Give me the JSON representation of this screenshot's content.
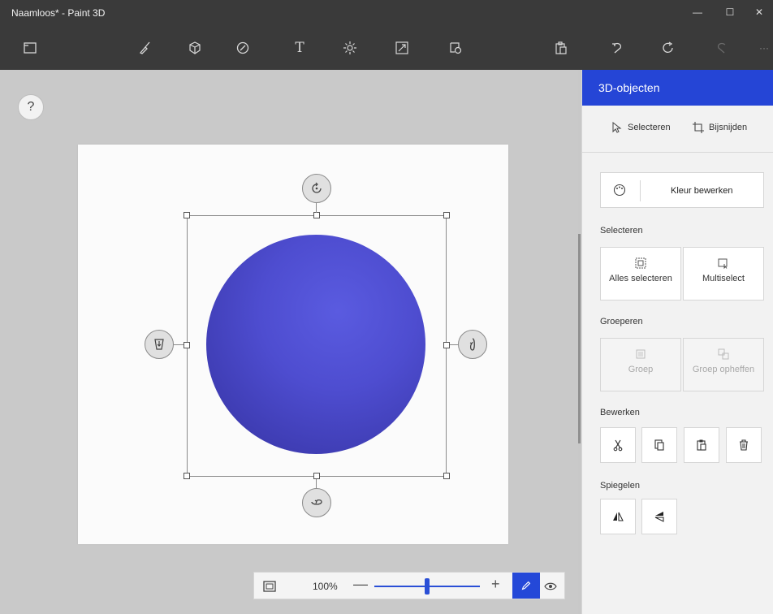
{
  "window": {
    "title": "Naamloos* - Paint 3D",
    "minimize": "—",
    "maximize": "☐",
    "close": "✕"
  },
  "toolbar": {
    "items": [
      {
        "icon": "menu-icon"
      },
      {
        "icon": "brush-icon"
      },
      {
        "icon": "3d-shapes-icon"
      },
      {
        "icon": "stickers-icon"
      },
      {
        "icon": "text-icon"
      },
      {
        "icon": "effects-icon"
      },
      {
        "icon": "canvas-icon"
      },
      {
        "icon": "3d-library-icon"
      },
      {
        "icon": "paste-icon"
      },
      {
        "icon": "undo-icon"
      },
      {
        "icon": "history-icon"
      },
      {
        "icon": "redo-icon"
      },
      {
        "icon": "more-icon"
      }
    ],
    "more_label": "···"
  },
  "workspace": {
    "help_label": "?",
    "zoom_label": "100%",
    "zoom_minus": "—",
    "zoom_plus": "+",
    "zoom_level": 0.5
  },
  "panel": {
    "title": "3D-objecten",
    "select_label": "Selecteren",
    "crop_label": "Bijsnijden",
    "edit_color_label": "Kleur bewerken",
    "section_select": "Selecteren",
    "select_all": "Alles selecteren",
    "multiselect": "Multiselect",
    "section_group": "Groeperen",
    "group": "Groep",
    "ungroup": "Groep opheffen",
    "section_edit": "Bewerken",
    "section_mirror": "Spiegelen"
  },
  "colors": {
    "accent": "#2545d6",
    "sphere": "#4b4bd0",
    "chrome": "#3a3a3a"
  }
}
